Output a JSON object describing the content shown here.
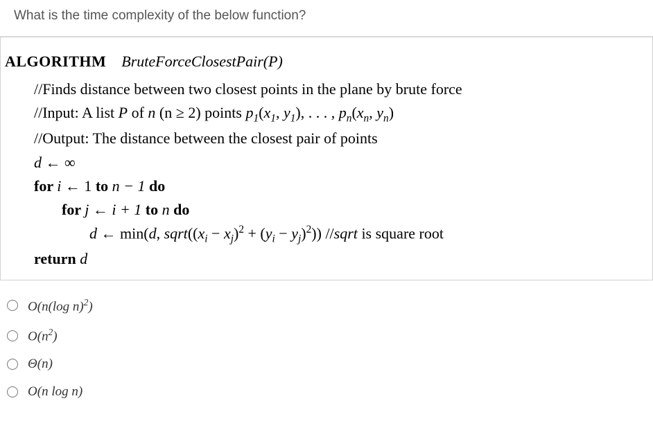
{
  "question": "What is the time complexity of the below function?",
  "algorithm": {
    "keyword": "ALGORITHM",
    "name": "BruteForceClosestPair(P)",
    "comment1": "//Finds distance between two closest points in the plane by brute force",
    "comment2_prefix": "//Input: A list ",
    "comment2_mid": " of ",
    "comment2_cond": " (n ≥ 2) points ",
    "comment3": "//Output: The distance between the closest pair of points",
    "line1_var": "d",
    "line1_arrow": " ← ∞",
    "line2_for": "for ",
    "line2_var": "i",
    "line2_rest": " ← 1 ",
    "line2_to": "to ",
    "line2_end": "n − 1 ",
    "line2_do": "do",
    "line3_for": "for ",
    "line3_var": "j",
    "line3_rest": " ← ",
    "line3_expr": "i + 1 ",
    "line3_to": "to ",
    "line3_n": "n ",
    "line3_do": "do",
    "line4_d": "d",
    "line4_arrow": " ← min(",
    "line4_d2": "d",
    "line4_mid": ", ",
    "line4_sqrt": "sqrt",
    "line4_expr_open": "((",
    "line4_xi": "x",
    "line4_minus": " − ",
    "line4_xj": "x",
    "line4_close1": ")",
    "line4_plus": " + (",
    "line4_yi": "y",
    "line4_yj": "y",
    "line4_close2": ")",
    "line4_close3": ")) //",
    "line4_sqrt2": "sqrt",
    "line4_comment": " is square root",
    "return_kw": "return ",
    "return_var": "d",
    "sub_i": "i",
    "sub_j": "j",
    "sub_1": "1",
    "sub_n": "n",
    "sup_2": "2",
    "P_var": "P",
    "n_var": "n",
    "p_var": "p",
    "x_var": "x",
    "y_var": "y",
    "dots": ", . . . , "
  },
  "options": [
    {
      "id": "opt1",
      "html": "O(n(log n)²)"
    },
    {
      "id": "opt2",
      "html": "O(n²)"
    },
    {
      "id": "opt3",
      "html": "Θ(n)"
    },
    {
      "id": "opt4",
      "html": "O(n log n)"
    }
  ]
}
